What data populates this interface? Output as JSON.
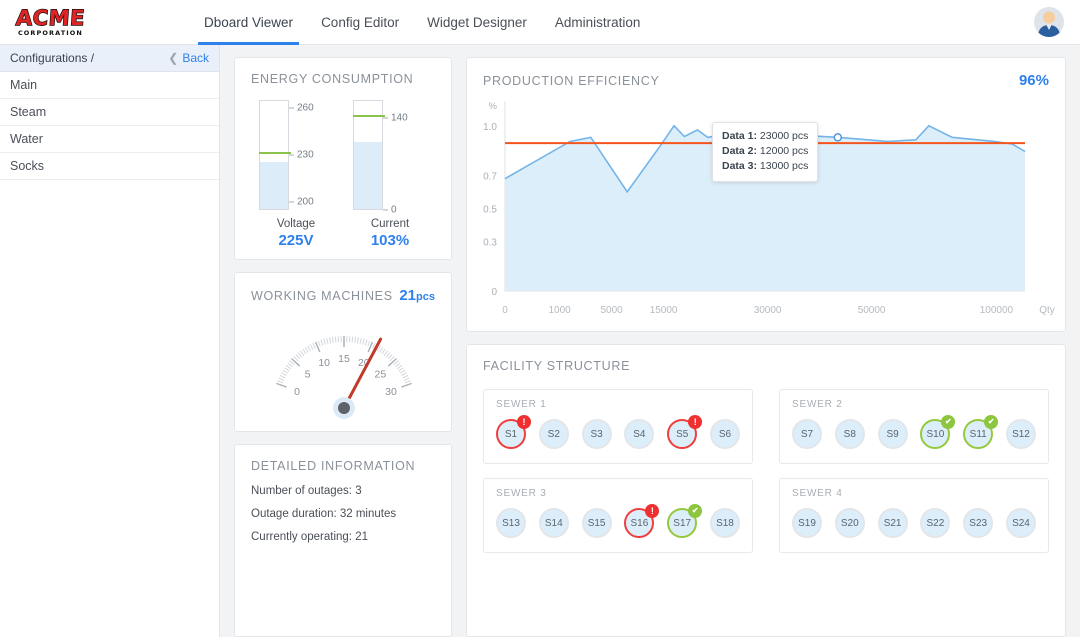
{
  "header": {
    "logo_main": "ACME",
    "logo_sub": "CORPORATION",
    "nav": [
      {
        "label": "Dboard Viewer",
        "active": true
      },
      {
        "label": "Config Editor",
        "active": false
      },
      {
        "label": "Widget Designer",
        "active": false
      },
      {
        "label": "Administration",
        "active": false
      }
    ],
    "avatar_icon": "user-avatar-icon"
  },
  "sidebar": {
    "title": "Configurations /",
    "back_label": "Back",
    "back_icon": "chevron-left-icon",
    "items": [
      {
        "label": "Main"
      },
      {
        "label": "Steam"
      },
      {
        "label": "Water"
      },
      {
        "label": "Socks"
      }
    ]
  },
  "energy": {
    "title": "Energy Consumption",
    "gauges": [
      {
        "label": "Voltage",
        "value_text": "225V",
        "value": 225,
        "min": 195,
        "max": 265,
        "threshold": 230,
        "ticks": [
          {
            "label": "260",
            "value": 260
          },
          {
            "label": "230",
            "value": 230
          },
          {
            "label": "200",
            "value": 200
          }
        ]
      },
      {
        "label": "Current",
        "value_text": "103%",
        "value": 103,
        "min": 0,
        "max": 168,
        "threshold": 140,
        "ticks": [
          {
            "label": "140",
            "value": 140
          },
          {
            "label": "0",
            "value": 0
          }
        ]
      }
    ]
  },
  "working_machines": {
    "title": "Working Machines",
    "value": "21",
    "unit": "pcs",
    "gauge": {
      "min": 0,
      "max": 30,
      "needle_value": 21,
      "major_ticks": [
        "0",
        "5",
        "10",
        "15",
        "20",
        "25",
        "30"
      ]
    }
  },
  "detail": {
    "title": "Detailed Information",
    "lines": [
      "Number of outages: 3",
      "Outage duration: 32 minutes",
      "Currently operating: 21"
    ]
  },
  "production": {
    "title": "Production Efficiency",
    "value": "96%",
    "tooltip": [
      "Data 1: 23000 pcs",
      "Data 2: 12000 pcs",
      "Data 3: 13000 pcs"
    ]
  },
  "chart_data": {
    "type": "area",
    "title": "Production Efficiency",
    "xlabel": "Qty",
    "ylabel": "%",
    "ylim": [
      0,
      1.15
    ],
    "ytick_labels": [
      "1.0",
      "0.7",
      "0.5",
      "0.3",
      "0"
    ],
    "ytick_values": [
      1.0,
      0.7,
      0.5,
      0.3,
      0
    ],
    "xtick_labels": [
      "0",
      "1000",
      "5000",
      "15000",
      "30000",
      "50000",
      "100000"
    ],
    "xtick_positions": [
      0,
      0.105,
      0.205,
      0.305,
      0.505,
      0.705,
      0.945
    ],
    "grid": false,
    "legend": "none",
    "threshold_line": {
      "value": 0.895,
      "color": "#f4541d",
      "label": ""
    },
    "series": [
      {
        "name": "Efficiency",
        "color": "#74b4e8",
        "fill": "#ddeefb",
        "x": [
          0.0,
          0.125,
          0.165,
          0.235,
          0.3,
          0.325,
          0.345,
          0.37,
          0.39,
          0.43,
          0.52,
          0.64,
          0.735,
          0.79,
          0.815,
          0.86,
          0.94,
          0.975,
          1.0
        ],
        "y": [
          0.68,
          0.905,
          0.93,
          0.6,
          0.885,
          1.0,
          0.935,
          0.975,
          0.93,
          0.955,
          0.95,
          0.93,
          0.905,
          0.915,
          1.0,
          0.93,
          0.905,
          0.89,
          0.845
        ]
      }
    ],
    "marker_point": {
      "x": 0.64,
      "y": 0.93
    },
    "tooltip_lines": [
      "Data 1: 23000 pcs",
      "Data 2: 12000 pcs",
      "Data 3: 13000 pcs"
    ]
  },
  "facility": {
    "title": "Facility Structure",
    "sewers": [
      {
        "name": "SEWER 1",
        "nodes": [
          {
            "label": "S1",
            "status": "alert"
          },
          {
            "label": "S2",
            "status": "normal"
          },
          {
            "label": "S3",
            "status": "normal"
          },
          {
            "label": "S4",
            "status": "normal"
          },
          {
            "label": "S5",
            "status": "alert"
          },
          {
            "label": "S6",
            "status": "normal"
          }
        ]
      },
      {
        "name": "SEWER 2",
        "nodes": [
          {
            "label": "S7",
            "status": "normal"
          },
          {
            "label": "S8",
            "status": "normal"
          },
          {
            "label": "S9",
            "status": "normal"
          },
          {
            "label": "S10",
            "status": "ok"
          },
          {
            "label": "S11",
            "status": "ok"
          },
          {
            "label": "S12",
            "status": "normal"
          }
        ]
      },
      {
        "name": "SEWER 3",
        "nodes": [
          {
            "label": "S13",
            "status": "normal"
          },
          {
            "label": "S14",
            "status": "normal"
          },
          {
            "label": "S15",
            "status": "normal"
          },
          {
            "label": "S16",
            "status": "alert"
          },
          {
            "label": "S17",
            "status": "ok"
          },
          {
            "label": "S18",
            "status": "normal"
          }
        ]
      },
      {
        "name": "SEWER 4",
        "nodes": [
          {
            "label": "S19",
            "status": "normal"
          },
          {
            "label": "S20",
            "status": "normal"
          },
          {
            "label": "S21",
            "status": "normal"
          },
          {
            "label": "S22",
            "status": "normal"
          },
          {
            "label": "S23",
            "status": "normal"
          },
          {
            "label": "S24",
            "status": "normal"
          }
        ]
      }
    ]
  },
  "colors": {
    "accent": "#2f80ed",
    "alert": "#f03030",
    "ok": "#8cc63e",
    "threshold": "#8bc34a",
    "chart_line": "#74b4e8",
    "chart_fill": "#ddeefb",
    "chart_threshold": "#f4541d"
  }
}
